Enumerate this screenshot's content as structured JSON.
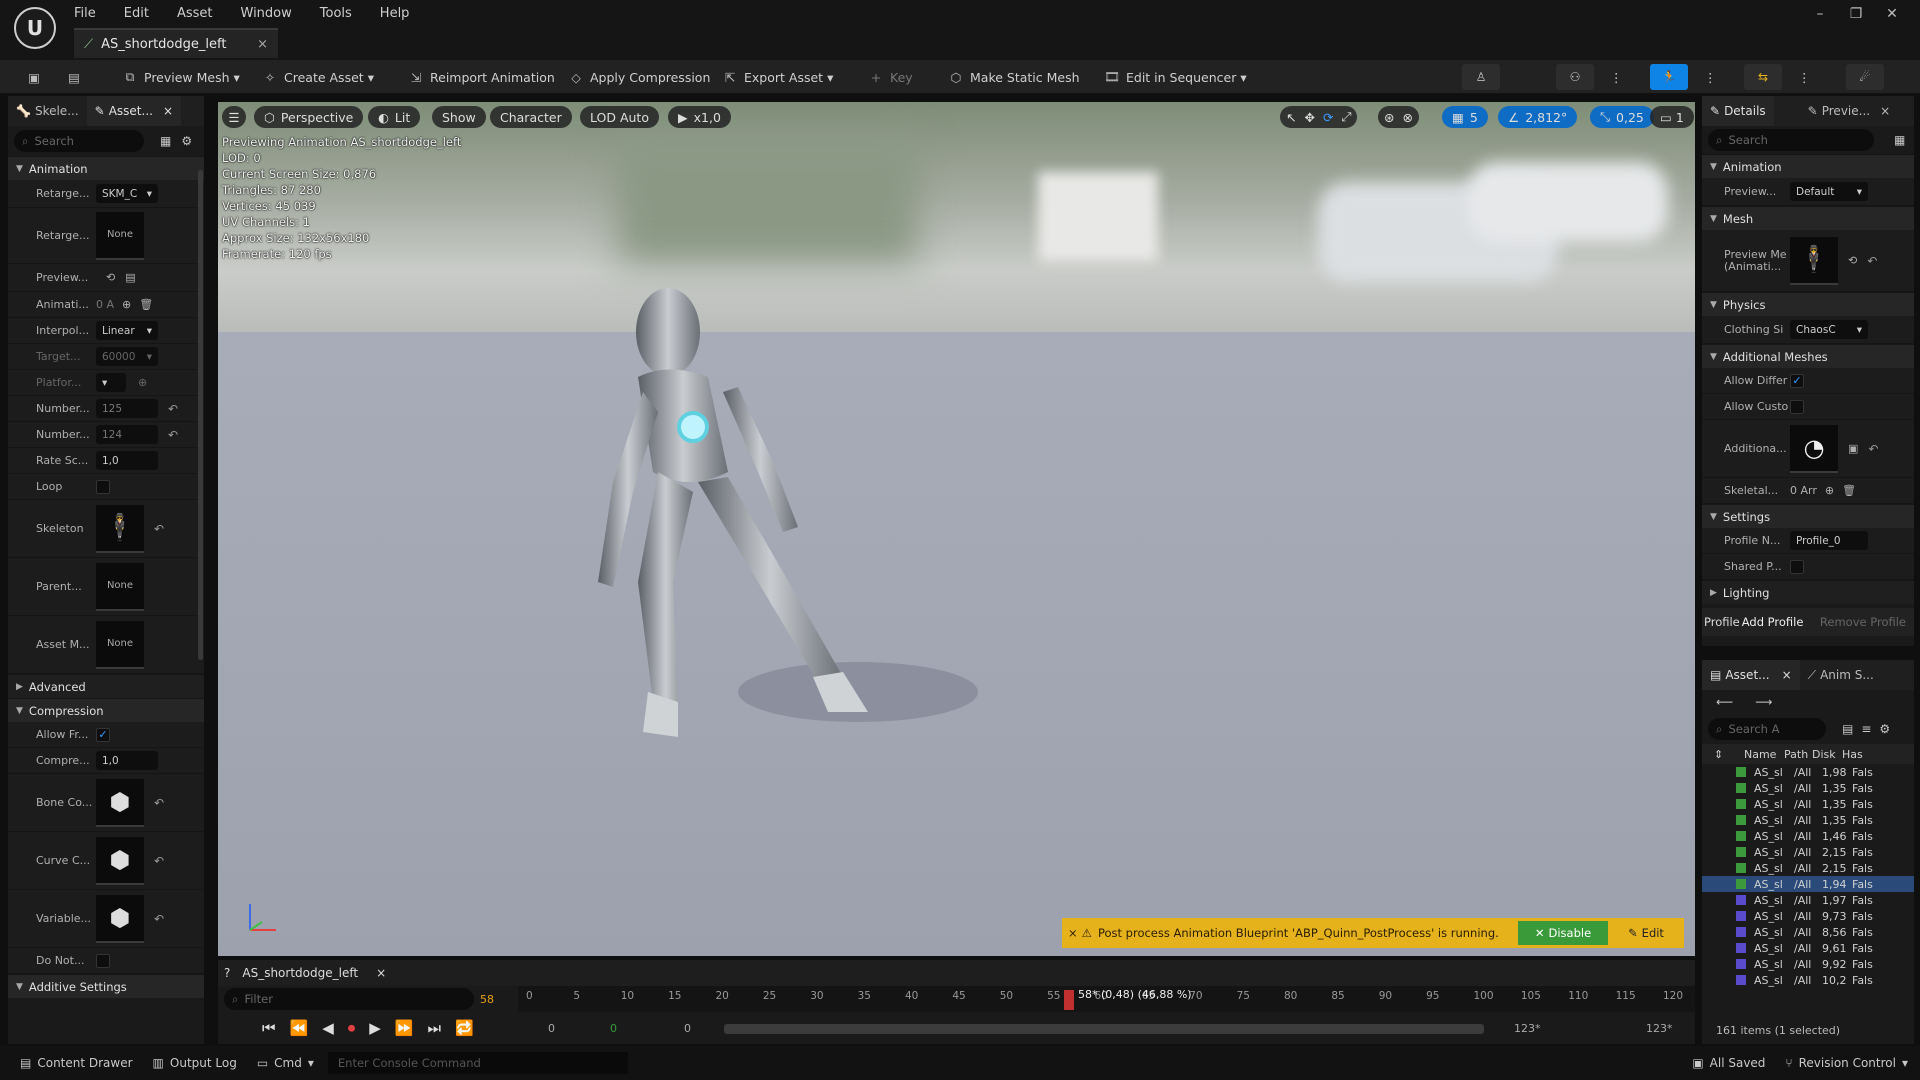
{
  "menu": [
    "File",
    "Edit",
    "Asset",
    "Window",
    "Tools",
    "Help"
  ],
  "doc_tab": {
    "label": "AS_shortdodge_left",
    "close": "×"
  },
  "toolbar": {
    "preview_mesh": "Preview Mesh",
    "create_asset": "Create Asset",
    "reimport": "Reimport Animation",
    "apply_compression": "Apply Compression",
    "export_asset": "Export Asset",
    "key": "Key",
    "make_static": "Make Static Mesh",
    "edit_sequencer": "Edit in Sequencer"
  },
  "left": {
    "tabs": [
      "Skele...",
      "Asset..."
    ],
    "search_placeholder": "Search",
    "animation_cat": "Animation",
    "rows": {
      "retarget1": {
        "label": "Retarge...",
        "value": "SKM_C"
      },
      "retarget2": {
        "label": "Retarge...",
        "value": "None"
      },
      "preview": {
        "label": "Preview..."
      },
      "animati": {
        "label": "Animati...",
        "value": "0 A"
      },
      "interp": {
        "label": "Interpol...",
        "value": "Linear"
      },
      "target": {
        "label": "Target...",
        "value": "60000"
      },
      "platform": {
        "label": "Platfor..."
      },
      "number1": {
        "label": "Number...",
        "value": "125"
      },
      "number2": {
        "label": "Number...",
        "value": "124"
      },
      "rate": {
        "label": "Rate Sc...",
        "value": "1,0"
      },
      "loop": {
        "label": "Loop"
      },
      "skeleton": {
        "label": "Skeleton"
      },
      "parent": {
        "label": "Parent...",
        "value": "None"
      },
      "assetm": {
        "label": "Asset M...",
        "value": "None"
      }
    },
    "advanced_cat": "Advanced",
    "compression_cat": "Compression",
    "comp_rows": {
      "allow": {
        "label": "Allow Fr..."
      },
      "compre": {
        "label": "Compre...",
        "value": "1,0"
      },
      "bone": {
        "label": "Bone Co..."
      },
      "curve": {
        "label": "Curve C..."
      },
      "variable": {
        "label": "Variable..."
      },
      "donot": {
        "label": "Do Not..."
      }
    },
    "additive_cat": "Additive Settings"
  },
  "viewport": {
    "perspective": "Perspective",
    "lit": "Lit",
    "show": "Show",
    "character": "Character",
    "lod": "LOD Auto",
    "speed": "x1,0",
    "grid_val": "5",
    "angle_val": "2,812°",
    "scale_val": "0,25",
    "cam_val": "1",
    "stats": [
      "Previewing Animation AS_shortdodge_left",
      "LOD: 0",
      "Current Screen Size: 0,876",
      "Triangles: 87 280",
      "Vertices: 45 039",
      "UV Channels: 1",
      "Approx Size: 132x56x180",
      "Framerate: 120 fps"
    ],
    "warning": "Post process Animation Blueprint 'ABP_Quinn_PostProcess' is running.",
    "disable": "Disable",
    "edit": "Edit"
  },
  "timeline": {
    "tab": "AS_shortdodge_left",
    "filter_placeholder": "Filter",
    "frame_marker": "58",
    "playhead": "58* (0,48) (46,88 %)",
    "ticks": [
      "0",
      "5",
      "10",
      "15",
      "20",
      "25",
      "30",
      "35",
      "40",
      "45",
      "50",
      "55",
      "60",
      "65",
      "70",
      "75",
      "80",
      "85",
      "90",
      "95",
      "100",
      "105",
      "110",
      "115",
      "120"
    ],
    "start_vals": [
      "0",
      "0",
      "0"
    ],
    "end_val": "123*",
    "end_val2": "123*"
  },
  "right": {
    "tabs": [
      "Details",
      "Previe..."
    ],
    "search_placeholder": "Search",
    "animation_cat": "Animation",
    "preview": {
      "label": "Preview...",
      "value": "Default"
    },
    "mesh_cat": "Mesh",
    "preview_mesh": {
      "label": "Preview Me\n(Animati..."
    },
    "physics_cat": "Physics",
    "clothing": {
      "label": "Clothing Si",
      "value": "ChaosC"
    },
    "additional_cat": "Additional Meshes",
    "allow_diff": {
      "label": "Allow Differ"
    },
    "allow_cust": {
      "label": "Allow Custo"
    },
    "additional": {
      "label": "Additiona..."
    },
    "skeletal": {
      "label": "Skeletal...",
      "value": "0 Arr"
    },
    "settings_cat": "Settings",
    "profile": {
      "label": "Profile N...",
      "value": "Profile_0"
    },
    "shared": {
      "label": "Shared P..."
    },
    "lighting_cat": "Lighting",
    "profile_btn": "Profile",
    "add_profile": "Add Profile",
    "remove_profile": "Remove Profile"
  },
  "assets": {
    "tabs": [
      "Asset...",
      "Anim S..."
    ],
    "search_placeholder": "Search A",
    "columns": [
      "Name",
      "Path",
      "Disk",
      "Has"
    ],
    "rows": [
      {
        "name": "AS_sl",
        "path": "/All",
        "disk": "1,98",
        "has": "Fals"
      },
      {
        "name": "AS_sl",
        "path": "/All",
        "disk": "1,35",
        "has": "Fals"
      },
      {
        "name": "AS_sl",
        "path": "/All",
        "disk": "1,35",
        "has": "Fals"
      },
      {
        "name": "AS_sl",
        "path": "/All",
        "disk": "1,35",
        "has": "Fals"
      },
      {
        "name": "AS_sl",
        "path": "/All",
        "disk": "1,46",
        "has": "Fals"
      },
      {
        "name": "AS_sl",
        "path": "/All",
        "disk": "2,15",
        "has": "Fals"
      },
      {
        "name": "AS_sl",
        "path": "/All",
        "disk": "2,15",
        "has": "Fals"
      },
      {
        "name": "AS_sl",
        "path": "/All",
        "disk": "1,94",
        "has": "Fals"
      },
      {
        "name": "AS_sl",
        "path": "/All",
        "disk": "1,97",
        "has": "Fals"
      },
      {
        "name": "AS_sl",
        "path": "/All",
        "disk": "9,73",
        "has": "Fals"
      },
      {
        "name": "AS_sl",
        "path": "/All",
        "disk": "8,56",
        "has": "Fals"
      },
      {
        "name": "AS_sl",
        "path": "/All",
        "disk": "9,61",
        "has": "Fals"
      },
      {
        "name": "AS_sl",
        "path": "/All",
        "disk": "9,92",
        "has": "Fals"
      },
      {
        "name": "AS_sl",
        "path": "/All",
        "disk": "10,2",
        "has": "Fals"
      }
    ],
    "count": "161 items (1 selected)"
  },
  "status": {
    "content_drawer": "Content Drawer",
    "output_log": "Output Log",
    "cmd": "Cmd",
    "console_placeholder": "Enter Console Command",
    "all_saved": "All Saved",
    "revision": "Revision Control"
  },
  "colors": {
    "accent": "#0e84e6",
    "warning": "#e6b21c",
    "disable": "#3a9a3a"
  }
}
